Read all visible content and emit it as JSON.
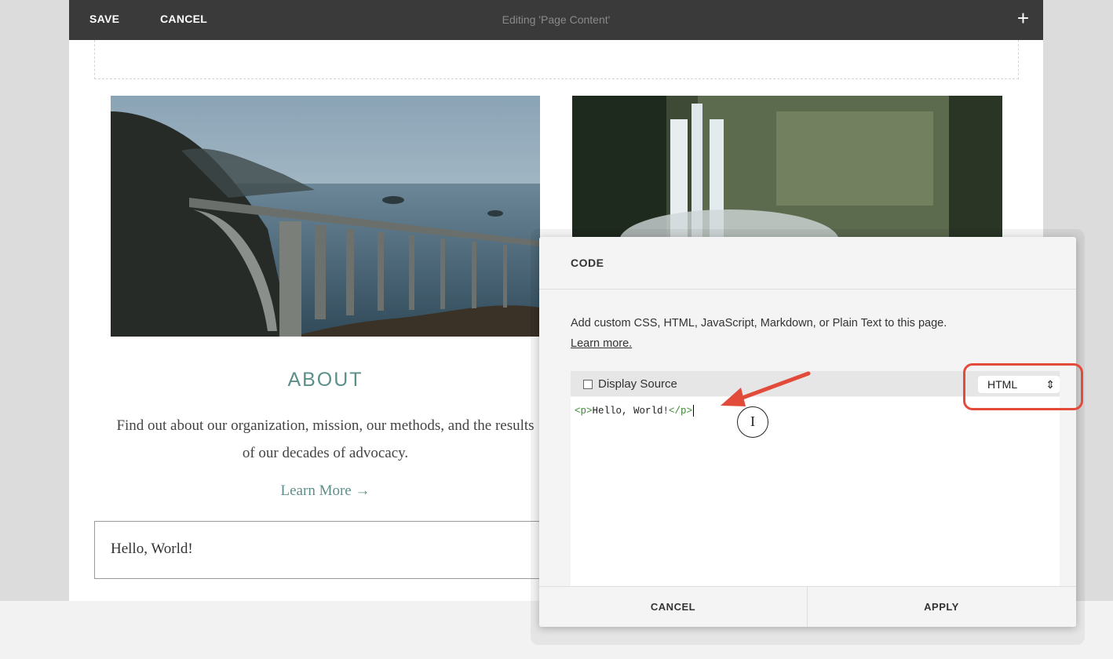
{
  "topbar": {
    "save_label": "SAVE",
    "cancel_label": "CANCEL",
    "title": "Editing 'Page Content'",
    "add_icon": "plus-icon"
  },
  "content": {
    "about_title": "ABOUT",
    "about_text": "Find out about our organization, mission, our methods, and the results of our decades of advocacy.",
    "learn_more": "Learn More →",
    "hello_block": "Hello, World!"
  },
  "code_dialog": {
    "title": "CODE",
    "description": "Add custom CSS, HTML, JavaScript, Markdown, or Plain Text to this page.",
    "learn_link": "Learn more.",
    "display_source_label": "Display Source",
    "language": "HTML",
    "code": {
      "open_tag": "<p>",
      "text": "Hello, World!",
      "close_tag": "</p>"
    },
    "cancel_label": "CANCEL",
    "apply_label": "APPLY"
  },
  "annotation_colors": {
    "highlight": "#e24a3a",
    "accent": "#5b8f8a"
  }
}
